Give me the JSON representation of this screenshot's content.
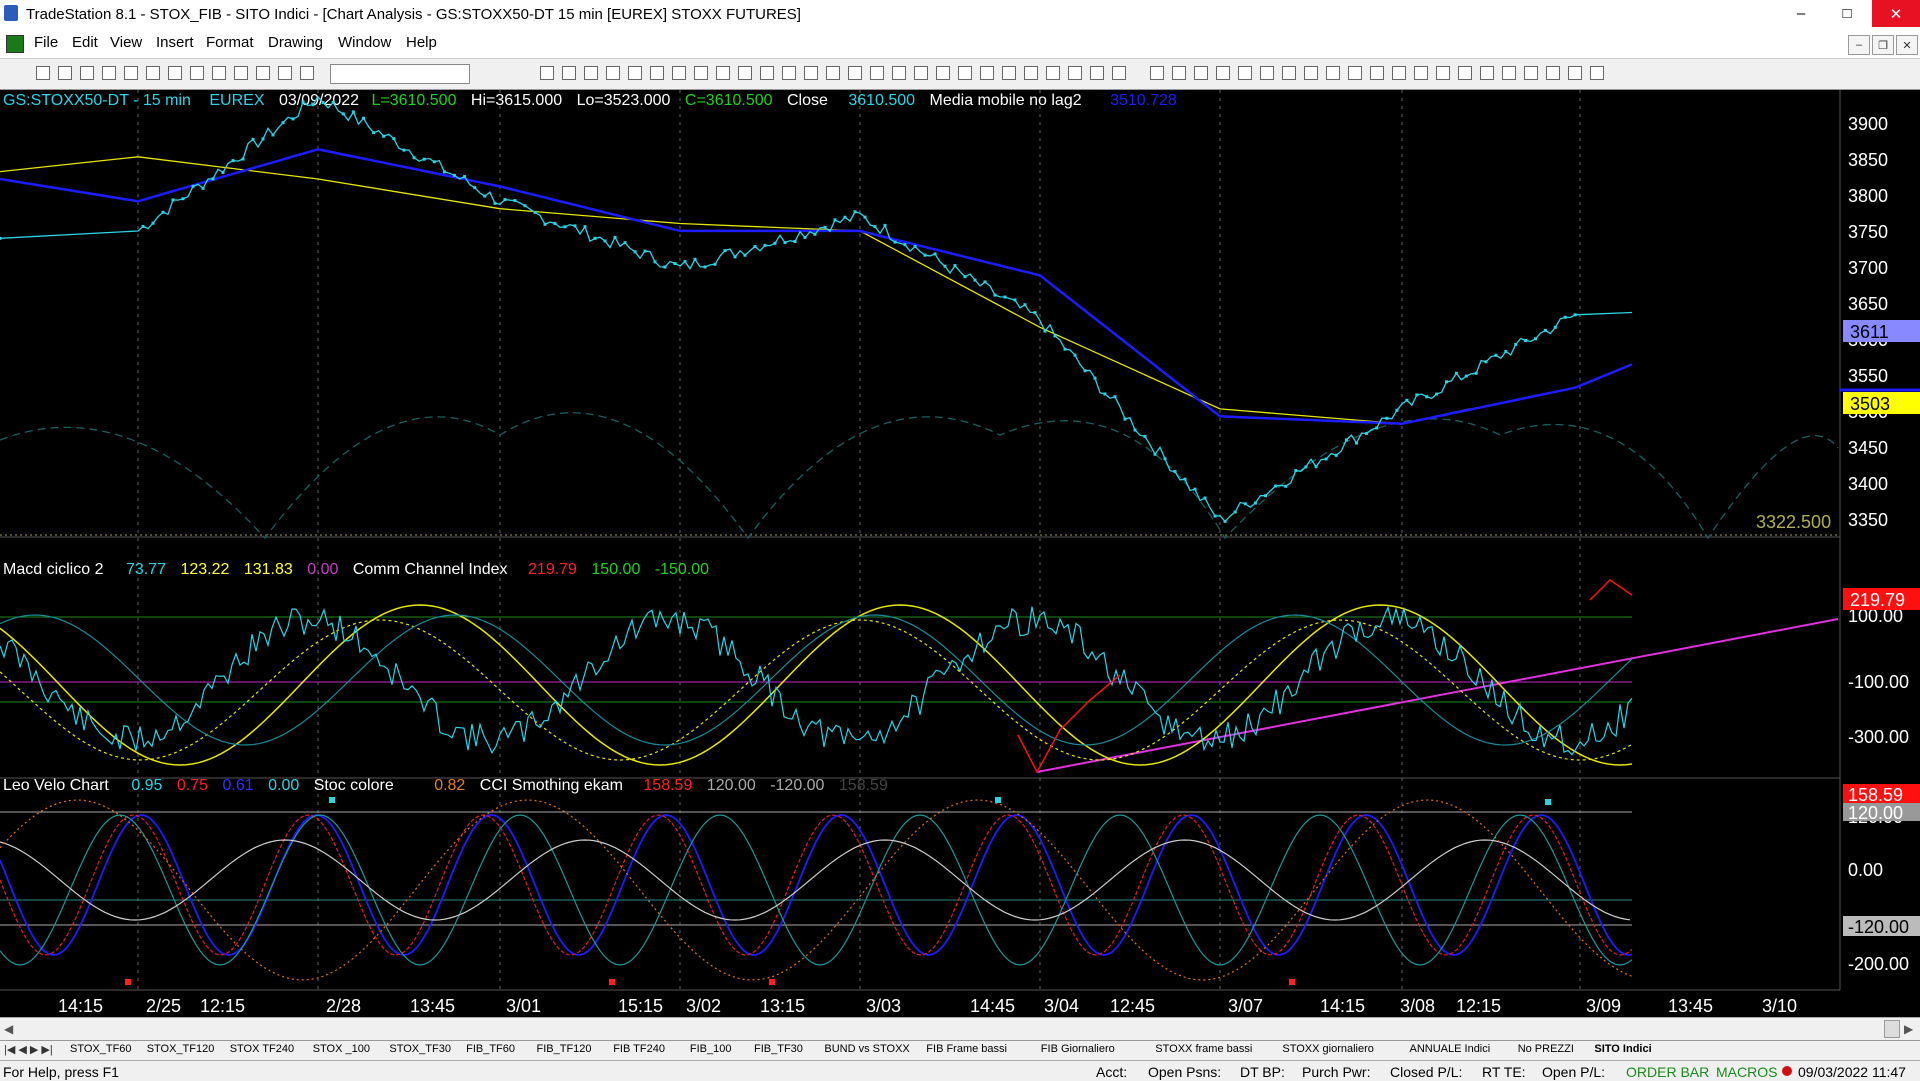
{
  "window": {
    "title": "TradeStation 8.1 - STOX_FIB - SITO Indici - [Chart Analysis - GS:STOXX50-DT  15 min  [EUREX] STOXX FUTURES]",
    "minimize": "–",
    "maximize": "□",
    "close": "✕"
  },
  "menu": {
    "items": [
      "File",
      "Edit",
      "View",
      "Insert",
      "Format",
      "Drawing",
      "Window",
      "Help"
    ],
    "mdi_min": "–",
    "mdi_restore": "❐",
    "mdi_close": "✕"
  },
  "chart_header": {
    "symbol": "GS:STOXX50-DT - 15 min",
    "exchange": "EUREX",
    "date": "03/09/2022",
    "last": "L=3610.500",
    "high": "Hi=3615.000",
    "low": "Lo=3523.000",
    "close": "C=3610.500",
    "close_label": "Close",
    "close_value": "3610.500",
    "ma_label": "Media mobile no lag2",
    "ma_value": "3510.728"
  },
  "panel2_header": {
    "name": "Macd ciclico 2",
    "v1": "73.77",
    "v2": "123.22",
    "v3": "131.83",
    "v4": "0.00",
    "name2": "Comm Channel Index",
    "v5": "219.79",
    "v6": "150.00",
    "v7": "-150.00"
  },
  "panel3_header": {
    "name": "Leo Velo Chart",
    "v1": "0.95",
    "v2": "0.75",
    "v3": "0.61",
    "v4": "0.00",
    "name2": "Stoc colore",
    "v5": "0.82",
    "name3": "CCI Smothing ekam",
    "v6": "158.59",
    "v7": "120.00",
    "v8": "-120.00",
    "v9": "158.59"
  },
  "price_axis": [
    "3900",
    "3850",
    "3800",
    "3750",
    "3700",
    "3650",
    "3600",
    "3550",
    "3500",
    "3450",
    "3400",
    "3350"
  ],
  "price_badges": {
    "last": "3611",
    "ma": "3503",
    "level": "3322.500"
  },
  "panel2_axis": [
    "100.00",
    "-100.00",
    "-300.00"
  ],
  "panel2_badge": "219.79",
  "panel3_axis": [
    "120.00",
    "0.00",
    "-120.00",
    "-200.00"
  ],
  "panel3_badges": {
    "cci": "158.59",
    "upper": "120.00",
    "lower": "-120.00"
  },
  "time_axis": [
    "14:15",
    "2/25",
    "12:15",
    "2/28",
    "13:45",
    "3/01",
    "15:15",
    "3/02",
    "13:15",
    "3/03",
    "14:45",
    "3/04",
    "12:45",
    "3/07",
    "14:15",
    "3/08",
    "12:15",
    "3/09",
    "13:45",
    "3/10"
  ],
  "colors": {
    "price": "#2ad4e6",
    "ma_blue": "#1c1cff",
    "ma_yellow": "#e6e600",
    "cyan_text": "#2ad4e6",
    "yellow_text": "#ffff3c",
    "green_text": "#1fd21f",
    "red_text": "#ff2020",
    "magenta": "#e030e0"
  },
  "chart_data": [
    {
      "type": "line",
      "title": "GS:STOXX50-DT - 15 min",
      "x": [
        "2/25",
        "2/28",
        "3/01",
        "3/02",
        "3/03",
        "3/04",
        "3/07",
        "3/08",
        "3/09",
        "3/10"
      ],
      "series": [
        {
          "name": "Close",
          "values": [
            3720,
            3900,
            3760,
            3670,
            3740,
            3600,
            3330,
            3480,
            3610,
            null
          ]
        },
        {
          "name": "Media mobile no lag2",
          "values": [
            3760,
            3830,
            3780,
            3720,
            3720,
            3660,
            3470,
            3460,
            3510,
            null
          ]
        }
      ],
      "ylim": [
        3310,
        3910
      ]
    },
    {
      "type": "line",
      "title": "Comm Channel Index",
      "series": [
        {
          "name": "Comm Channel Index",
          "last": 219.79
        }
      ],
      "ylim": [
        -400,
        300
      ]
    },
    {
      "type": "line",
      "title": "CCI Smothing ekam",
      "series": [
        {
          "name": "CCI Smothing ekam",
          "last": 158.59
        }
      ],
      "ylim": [
        -240,
        200
      ]
    }
  ],
  "tabs": [
    "STOX_TF60",
    "STOX_TF120",
    "STOX TF240",
    "STOX _100",
    "STOX_TF30",
    "FIB_TF60",
    "FIB_TF120",
    "FIB TF240",
    "FIB_100",
    "FIB_TF30",
    "BUND vs STOXX",
    "FIB Frame bassi",
    "FIB Giornaliero",
    "STOXX frame bassi",
    "STOXX giornaliero",
    "ANNUALE Indici",
    "No PREZZI",
    "SITO Indici"
  ],
  "status": {
    "help": "For Help, press F1",
    "acct": "Acct:",
    "open_psns": "Open Psns:",
    "dt_bp": "DT BP:",
    "purch_pwr": "Purch Pwr:",
    "closed_pl": "Closed P/L:",
    "rt_te": "RT TE:",
    "open_pl": "Open P/L:",
    "order_bar": "ORDER BAR",
    "macros": "MACROS",
    "datetime": "09/03/2022 11:47"
  }
}
